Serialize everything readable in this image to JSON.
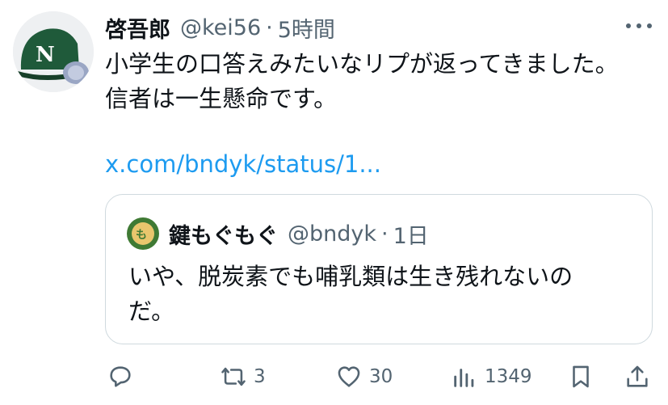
{
  "tweet": {
    "display_name": "啓吾郎",
    "handle": "@kei56",
    "separator": "·",
    "time": "5時間",
    "text_lines": [
      "小学生の口答えみたいなリプが返ってきました。",
      "信者は一生懸命です。"
    ],
    "link": "x.com/bndyk/status/1...",
    "avatar_icon": "baseball-cap-avatar",
    "more_icon": "more-options-icon"
  },
  "quote": {
    "display_name": "鍵もぐもぐ",
    "handle": "@bndyk",
    "separator": "·",
    "time": "1日",
    "text_lines": [
      "いや、脱炭素でも哺乳類は生き残れないの",
      "だ。"
    ],
    "avatar_icon": "mogu-avatar"
  },
  "actions": {
    "reply": {
      "icon": "reply-icon",
      "count": ""
    },
    "retweet": {
      "icon": "retweet-icon",
      "count": "3"
    },
    "like": {
      "icon": "heart-icon",
      "count": "30"
    },
    "views": {
      "icon": "views-icon",
      "count": "1349"
    },
    "bookmark": {
      "icon": "bookmark-icon"
    },
    "share": {
      "icon": "share-icon"
    }
  },
  "colors": {
    "text": "#0f1419",
    "secondary": "#536471",
    "link": "#1d9bf0",
    "border": "#cfd9de",
    "cap_green": "#1f5a3a"
  }
}
